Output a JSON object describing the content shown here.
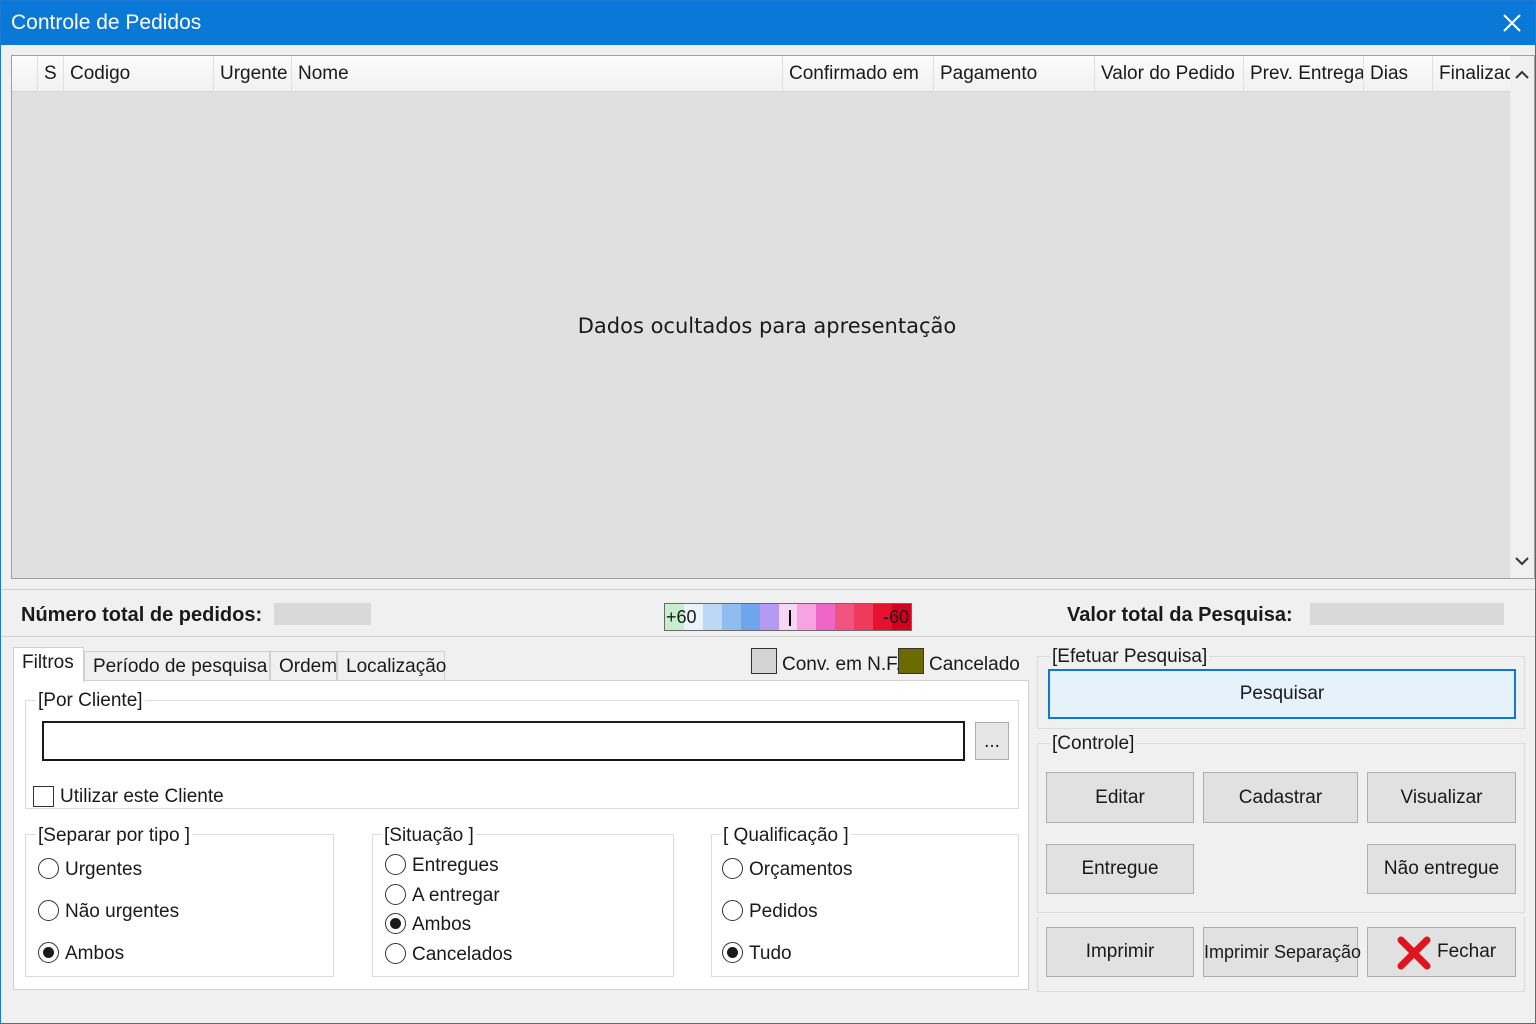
{
  "window": {
    "title": "Controle de Pedidos"
  },
  "grid": {
    "columns": [
      "S",
      "Codigo",
      "Urgente",
      "Nome",
      "Confirmado em",
      "Pagamento",
      "Valor do Pedido",
      "Prev. Entrega",
      "Dias",
      "Finalizado"
    ],
    "empty_message": "Dados ocultados para apresentação"
  },
  "summary": {
    "total_orders_label": "Número total de pedidos:",
    "total_value_label": "Valor total da Pesquisa:",
    "legend_left": "+60",
    "legend_right": "-60",
    "legend_colors": [
      "#c6efce",
      "#eaf3fb",
      "#bcd8f5",
      "#8fbdf0",
      "#6ea6ee",
      "#b49af0",
      "#f7d6f3",
      "#f7a3e2",
      "#f066c8",
      "#f0537f",
      "#f03a5b",
      "#e8102f",
      "#d4001f"
    ]
  },
  "tabs": [
    "Filtros",
    "Período de pesquisa",
    "Ordem",
    "Localização"
  ],
  "status_legend": {
    "nf_label": "Conv. em N.F.",
    "nf_color": "#d4d4d4",
    "cancel_label": "Cancelado",
    "cancel_color": "#6b6b00"
  },
  "filters": {
    "client_group": "[Por Cliente]",
    "client_value": "",
    "ellipsis": "...",
    "use_client": "Utilizar este Cliente",
    "type_group": "[Separar por tipo ]",
    "type_options": [
      "Urgentes",
      "Não urgentes",
      "Ambos"
    ],
    "situation_group": "[Situação ]",
    "situation_options": [
      "Entregues",
      "A entregar",
      "Ambos",
      "Cancelados"
    ],
    "qual_group": "[ Qualificação ]",
    "qual_options": [
      "Orçamentos",
      "Pedidos",
      "Tudo"
    ]
  },
  "search": {
    "group": "[Efetuar Pesquisa]",
    "button": "Pesquisar"
  },
  "control": {
    "group": "[Controle]",
    "edit": "Editar",
    "register": "Cadastrar",
    "view": "Visualizar",
    "delivered": "Entregue",
    "not_delivered": "Não entregue",
    "print": "Imprimir",
    "print_separation": "Imprimir Separação",
    "close": "Fechar"
  },
  "icons": {
    "close": "close-icon",
    "fechar": "red-x-icon",
    "scroll_up": "chevron-up-icon",
    "scroll_down": "chevron-down-icon"
  }
}
